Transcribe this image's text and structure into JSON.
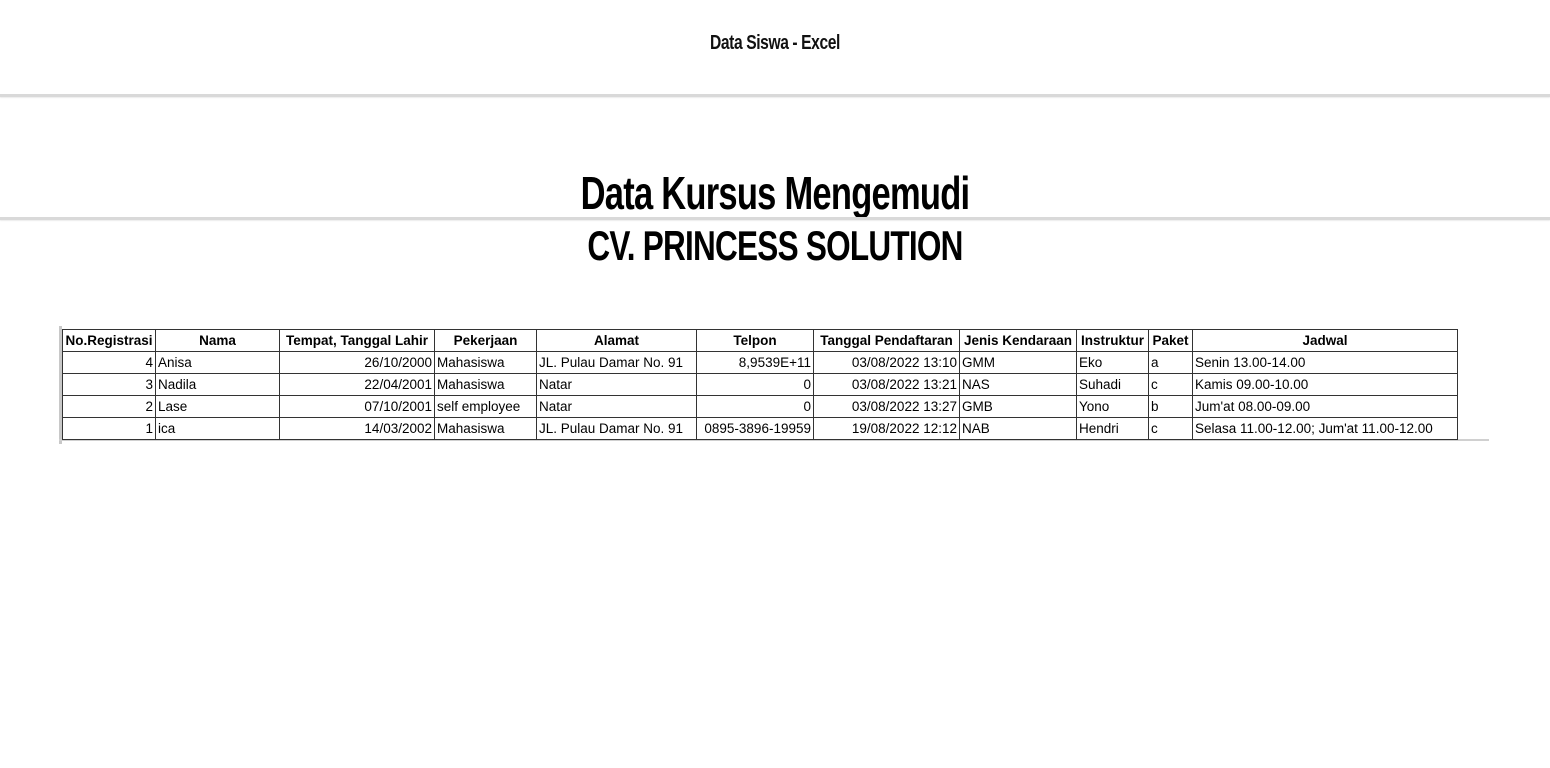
{
  "window": {
    "title": "Data Siswa - Excel"
  },
  "report": {
    "title": "Data Kursus Mengemudi",
    "subtitle": "CV. PRINCESS SOLUTION"
  },
  "table": {
    "headers": [
      "No.Registrasi",
      "Nama",
      "Tempat, Tanggal Lahir",
      "Pekerjaan",
      "Alamat",
      "Telpon",
      "Tanggal Pendaftaran",
      "Jenis Kendaraan",
      "Instruktur",
      "Paket",
      "Jadwal"
    ],
    "rows": [
      {
        "no": "4",
        "nama": "Anisa",
        "ttl": "26/10/2000",
        "pekerjaan": "Mahasiswa",
        "alamat": "JL. Pulau Damar No. 91",
        "telpon": "8,9539E+11",
        "tanggal": "03/08/2022 13:10",
        "kendaraan": "GMM",
        "instruktur": "Eko",
        "paket": "a",
        "jadwal": "Senin 13.00-14.00"
      },
      {
        "no": "3",
        "nama": "Nadila",
        "ttl": "22/04/2001",
        "pekerjaan": "Mahasiswa",
        "alamat": "Natar",
        "telpon": "0",
        "tanggal": "03/08/2022 13:21",
        "kendaraan": "NAS",
        "instruktur": "Suhadi",
        "paket": "c",
        "jadwal": "Kamis 09.00-10.00"
      },
      {
        "no": "2",
        "nama": "Lase",
        "ttl": "07/10/2001",
        "pekerjaan": "self employee",
        "alamat": "Natar",
        "telpon": "0",
        "tanggal": "03/08/2022 13:27",
        "kendaraan": "GMB",
        "instruktur": "Yono",
        "paket": "b",
        "jadwal": "Jum'at 08.00-09.00"
      },
      {
        "no": "1",
        "nama": "ica",
        "ttl": "14/03/2002",
        "pekerjaan": "Mahasiswa",
        "alamat": "JL. Pulau Damar No. 91",
        "telpon": "0895-3896-19959",
        "tanggal": "19/08/2022 12:12",
        "kendaraan": "NAB",
        "instruktur": "Hendri",
        "paket": "c",
        "jadwal": "Selasa 11.00-12.00; Jum'at 11.00-12.00"
      }
    ]
  }
}
